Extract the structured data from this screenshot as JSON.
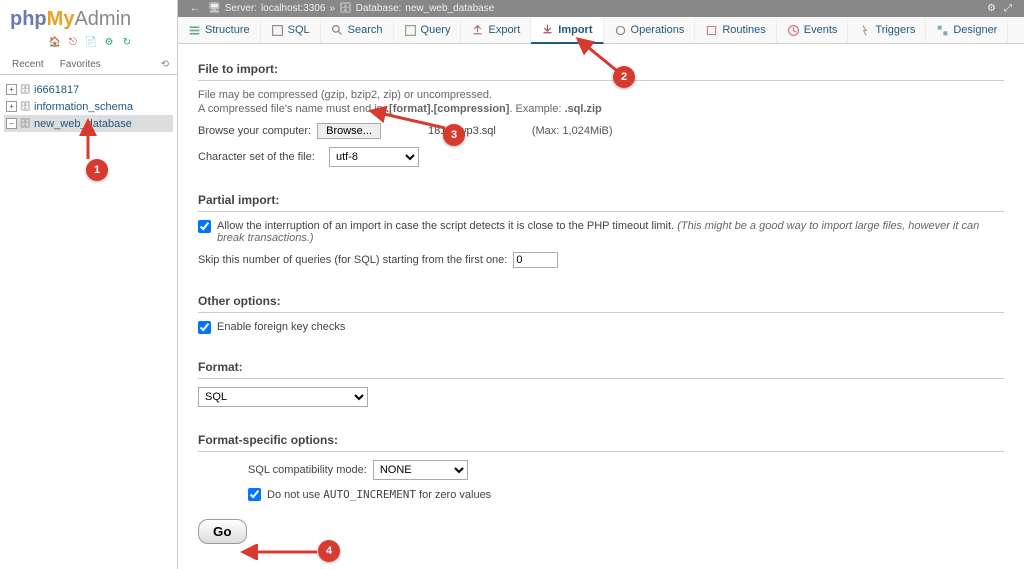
{
  "logo": {
    "php": "php",
    "my": "My",
    "admin": "Admin"
  },
  "sidebar": {
    "tabs": {
      "recent": "Recent",
      "favorites": "Favorites"
    },
    "dbs": [
      {
        "name": "i6661817"
      },
      {
        "name": "information_schema"
      },
      {
        "name": "new_web_database",
        "selected": true
      }
    ]
  },
  "breadcrumb": {
    "server_label": "Server:",
    "server": "localhost:3306",
    "db_label": "Database:",
    "db": "new_web_database"
  },
  "tabs": [
    {
      "id": "structure",
      "label": "Structure"
    },
    {
      "id": "sql",
      "label": "SQL"
    },
    {
      "id": "search",
      "label": "Search"
    },
    {
      "id": "query",
      "label": "Query"
    },
    {
      "id": "export",
      "label": "Export"
    },
    {
      "id": "import",
      "label": "Import",
      "active": true
    },
    {
      "id": "operations",
      "label": "Operations"
    },
    {
      "id": "routines",
      "label": "Routines"
    },
    {
      "id": "events",
      "label": "Events"
    },
    {
      "id": "triggers",
      "label": "Triggers"
    },
    {
      "id": "designer",
      "label": "Designer"
    }
  ],
  "import": {
    "file_heading": "File to import:",
    "hint1": "File may be compressed (gzip, bzip2, zip) or uncompressed.",
    "hint2a": "A compressed file's name must end in ",
    "hint2b": ".[format].[compression]",
    "hint2c": ". Example: ",
    "hint2d": ".sql.zip",
    "browse_label": "Browse your computer:",
    "browse_btn": "Browse...",
    "selected_file": "1817_wp3.sql",
    "max_size": "(Max: 1,024MiB)",
    "charset_label": "Character set of the file:",
    "charset": "utf-8",
    "partial_heading": "Partial import:",
    "allow_interrupt": "Allow the interruption of an import in case the script detects it is close to the PHP timeout limit.",
    "allow_interrupt_note": "(This might be a good way to import large files, however it can break transactions.)",
    "skip_label": "Skip this number of queries (for SQL) starting from the first one:",
    "skip_value": "0",
    "other_heading": "Other options:",
    "fk_checks": "Enable foreign key checks",
    "format_heading": "Format:",
    "format": "SQL",
    "fso_heading": "Format-specific options:",
    "compat_label": "SQL compatibility mode:",
    "compat": "NONE",
    "auto_inc": "Do not use ",
    "auto_inc_code": "AUTO_INCREMENT",
    "auto_inc2": " for zero values",
    "go": "Go"
  },
  "markers": {
    "m1": "1",
    "m2": "2",
    "m3": "3",
    "m4": "4"
  }
}
